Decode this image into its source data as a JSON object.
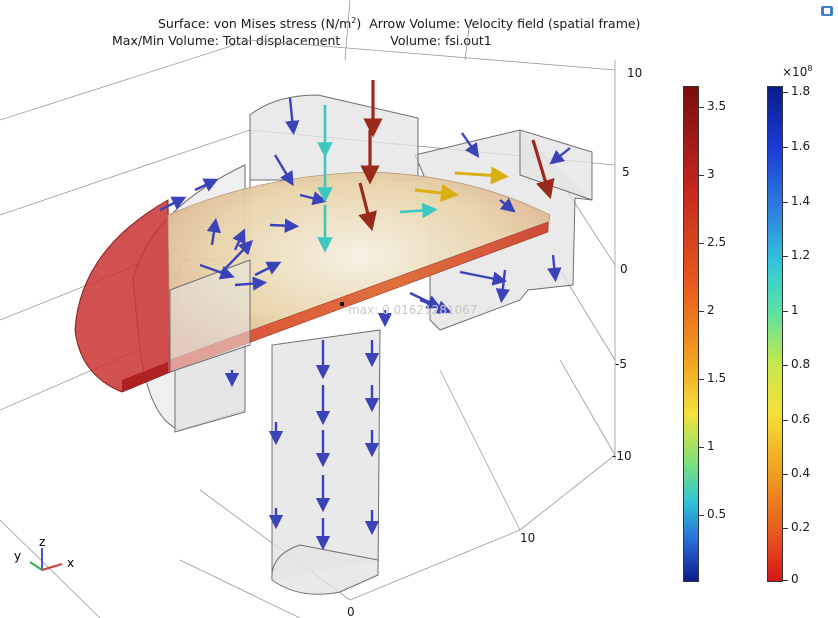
{
  "plot_title": {
    "line1_surface": "Surface: von Mises stress (N/m",
    "line1_sup": "2",
    "line1_close": ")",
    "line1_arrow": "Arrow Volume: Velocity field (spatial frame)",
    "line2_maxmin": "Max/Min Volume: Total displacement",
    "line2_volume": "Volume: fsi.out1"
  },
  "max_marker_label": "max: 0.01621281067",
  "grid_axis_labels": {
    "right": [
      "10",
      "5",
      "0",
      "-5",
      "-10"
    ],
    "bottom": [
      "10",
      "0"
    ]
  },
  "triad": {
    "y": "y",
    "z": "z",
    "x": "x"
  },
  "colorbars": [
    {
      "name": "displacement",
      "colormap": "heat",
      "top_color": "#7a0e0e",
      "ticks": [
        "3.5",
        "3",
        "2.5",
        "2",
        "1.5",
        "1",
        "0.5"
      ]
    },
    {
      "name": "stress",
      "colormap": "rainbow",
      "multiplier": "×10",
      "multiplier_exp": "8",
      "ticks": [
        "1.8",
        "1.6",
        "1.4",
        "1.2",
        "1",
        "0.8",
        "0.6",
        "0.4",
        "0.2",
        "0"
      ]
    }
  ],
  "colors": {
    "gray_body": "#e3e3e3",
    "gray_edge": "#6f6f6f",
    "plate_red": "#c93232",
    "surface_yellow": "#e8d9b0",
    "arrow_blue": "#3b43b8",
    "arrow_red": "#9a2a1a"
  }
}
